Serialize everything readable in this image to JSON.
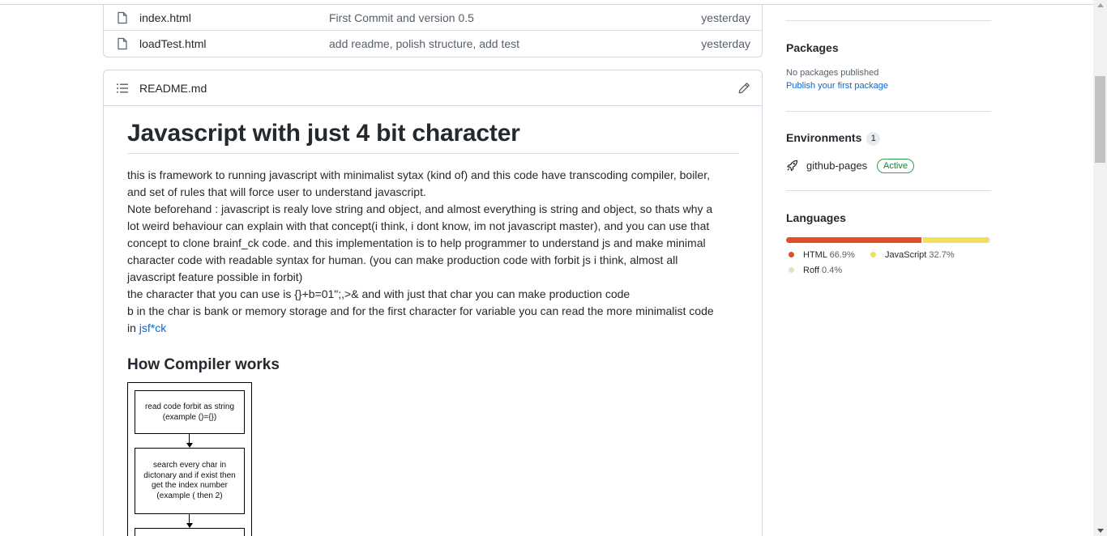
{
  "files": [
    {
      "name": "index.html",
      "message": "First Commit and version 0.5",
      "date": "yesterday"
    },
    {
      "name": "loadTest.html",
      "message": "add readme, polish structure, add test",
      "date": "yesterday"
    }
  ],
  "readme": {
    "filename": "README.md",
    "title": "Javascript with just 4 bit character",
    "lines": [
      "this is framework to running javascript with minimalist sytax (kind of) and this code have transcoding compiler, boiler,",
      "and set of rules that will force user to understand javascript.",
      "Note beforehand : javascript is realy love string and object, and almost everything is string and object, so thats why a",
      "lot weird behaviour can explain with that concept(i think, i dont know, im not javascript master), and you can use that",
      "concept to clone brainf_ck code. and this implementation is to help programmer to understand js and make minimal",
      "character code with readable syntax for human. (you can make production code with forbit js i think, almost all",
      "javascript feature possible in forbit)",
      "the character that you can use is {}+b=01\";,>& and with just that char you can make production code",
      "b in the char is bank or memory storage and for the first character for variable you can read the more minimalist code"
    ],
    "last_line_prefix": "in ",
    "link_text": "jsf*ck",
    "subheading": "How Compiler works",
    "flow": {
      "box1": [
        "read code forbit as string",
        "(example ()={})"
      ],
      "box2": [
        "search every char in",
        "dictonary and if exist then",
        "get the index number",
        "(example ( then 2)"
      ]
    }
  },
  "sidebar": {
    "packages": {
      "title": "Packages",
      "empty_text": "No packages published",
      "link": "Publish your first package"
    },
    "environments": {
      "title": "Environments",
      "count": "1",
      "name": "github-pages",
      "status": "Active"
    },
    "languages": {
      "title": "Languages",
      "items": [
        {
          "name": "HTML",
          "percent": "66.9%",
          "value": 66.9,
          "color": "#e34c26"
        },
        {
          "name": "JavaScript",
          "percent": "32.7%",
          "value": 32.7,
          "color": "#f1e05a"
        },
        {
          "name": "Roff",
          "percent": "0.4%",
          "value": 0.4,
          "color": "#ecdebe"
        }
      ]
    }
  }
}
